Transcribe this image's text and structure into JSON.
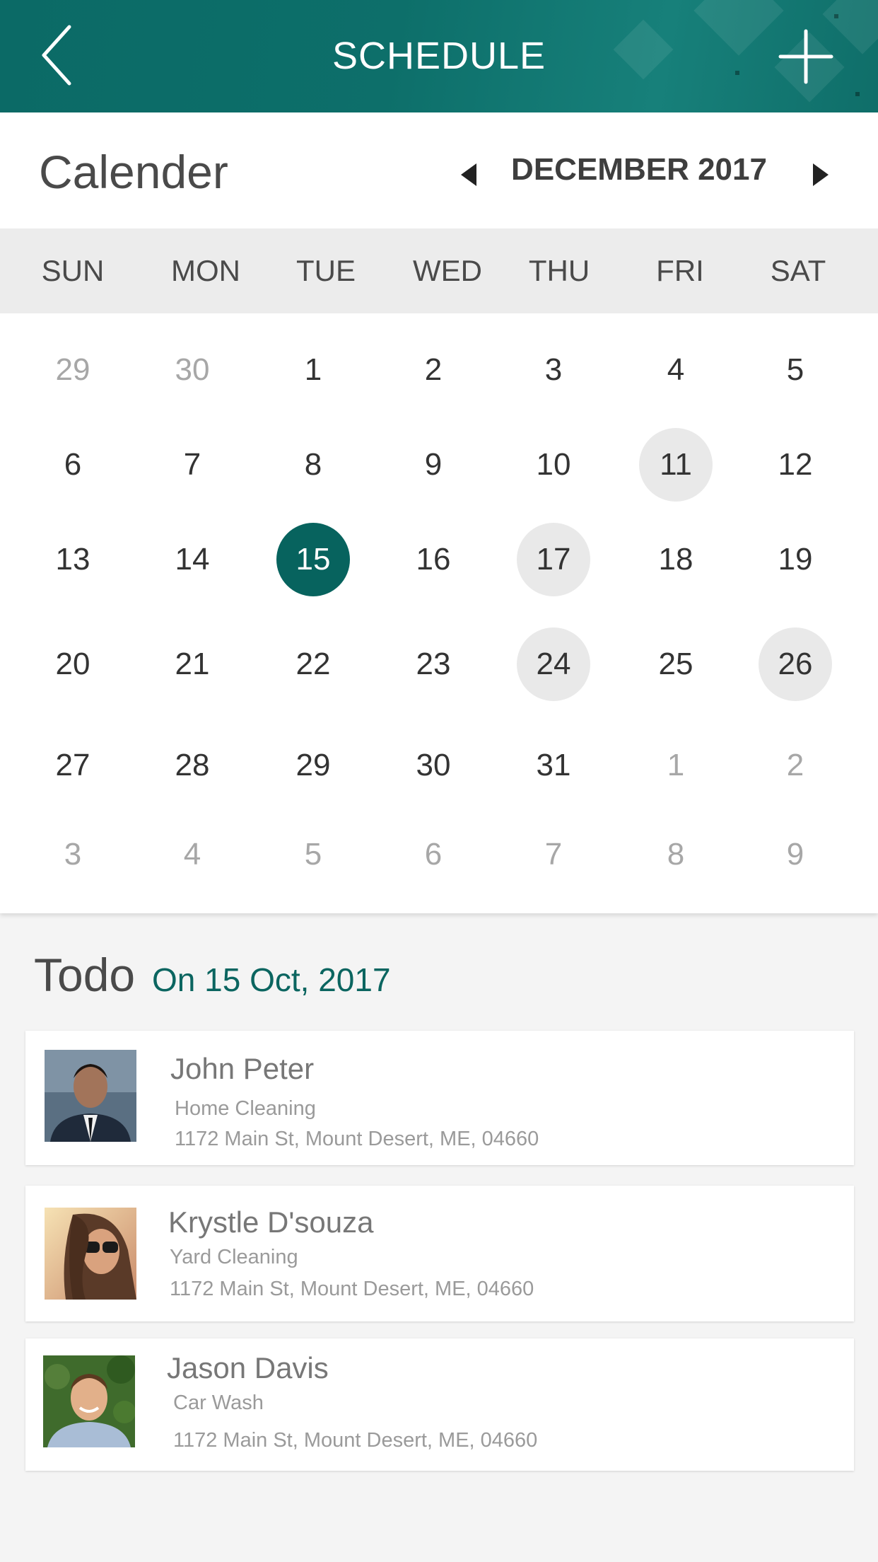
{
  "header": {
    "title": "SCHEDULE",
    "back_icon": "chevron-left-icon",
    "add_icon": "plus-icon",
    "accent": "#0b6a66"
  },
  "calendar": {
    "title": "Calender",
    "month_label": "DECEMBER 2017",
    "weekdays": [
      "SUN",
      "MON",
      "TUE",
      "WED",
      "THU",
      "FRI",
      "SAT"
    ],
    "weeks": [
      [
        "29",
        "30",
        "1",
        "2",
        "3",
        "4",
        "5"
      ],
      [
        "6",
        "7",
        "8",
        "9",
        "10",
        "11",
        "12"
      ],
      [
        "13",
        "14",
        "15",
        "16",
        "17",
        "18",
        "19"
      ],
      [
        "20",
        "21",
        "22",
        "23",
        "24",
        "25",
        "26"
      ],
      [
        "27",
        "28",
        "29",
        "30",
        "31",
        "1",
        "2"
      ],
      [
        "3",
        "4",
        "5",
        "6",
        "7",
        "8",
        "9"
      ]
    ],
    "selected_day": "15",
    "marked_days": [
      "11",
      "17",
      "24",
      "26"
    ],
    "selected_color": "#07635e"
  },
  "todo": {
    "title": "Todo",
    "date": "On 15 Oct, 2017",
    "items": [
      {
        "name": "John Peter",
        "service": "Home Cleaning",
        "address": "1172 Main St, Mount Desert, ME, 04660"
      },
      {
        "name": "Krystle D'souza",
        "service": "Yard Cleaning",
        "address": "1172 Main St, Mount Desert, ME, 04660"
      },
      {
        "name": "Jason Davis",
        "service": "Car Wash",
        "address": "1172 Main St, Mount Desert, ME, 04660"
      }
    ]
  }
}
